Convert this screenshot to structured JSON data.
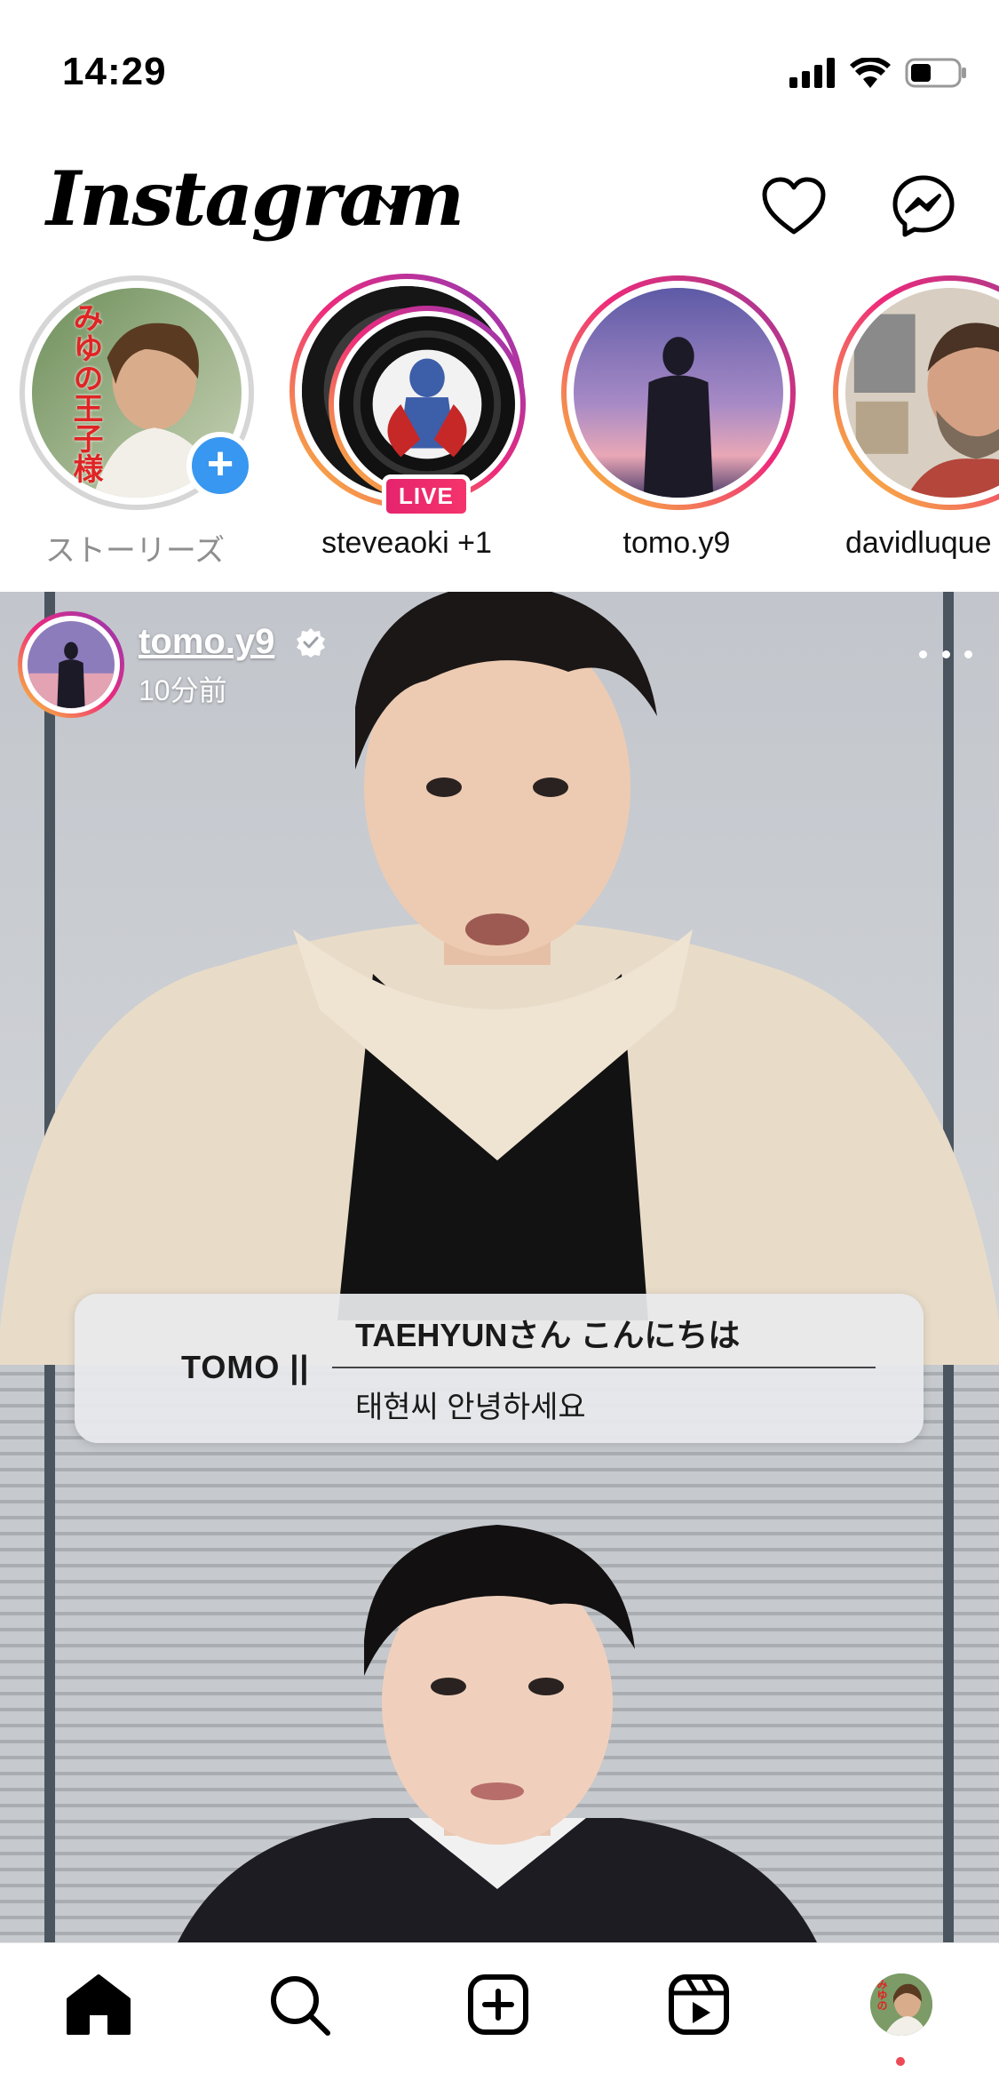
{
  "status_bar": {
    "time": "14:29",
    "icons": [
      "cellular-signal-icon",
      "wifi-icon",
      "battery-icon"
    ]
  },
  "header": {
    "logo": "Instagram",
    "icons": [
      "chevron-down-icon",
      "heart-icon",
      "messenger-icon"
    ]
  },
  "stories": [
    {
      "label": "ストーリーズ",
      "own": true,
      "add_icon": "+",
      "avatar_text": "みゆの王子様"
    },
    {
      "label": "steveaoki +1",
      "live": true,
      "live_label": "LIVE"
    },
    {
      "label": "tomo.y9"
    },
    {
      "label": "davidluque"
    }
  ],
  "post": {
    "username": "tomo.y9",
    "verified": true,
    "time": "10分前",
    "caption": {
      "speaker": "TOMO ||",
      "line1": "TAEHYUNさん こんにちは",
      "line2": "태현씨 안녕하세요"
    }
  },
  "bottom_nav": {
    "items": [
      "home-icon",
      "search-icon",
      "create-icon",
      "reels-icon",
      "profile-avatar"
    ],
    "profile_avatar_text": "みゆの",
    "notification_dot": true
  },
  "colors": {
    "live_badge": "#e6246e",
    "add_badge": "#3897f0",
    "notification_dot": "#ed4956",
    "story_ring_start": "#f9ce34",
    "story_ring_end": "#8a3ab9"
  }
}
